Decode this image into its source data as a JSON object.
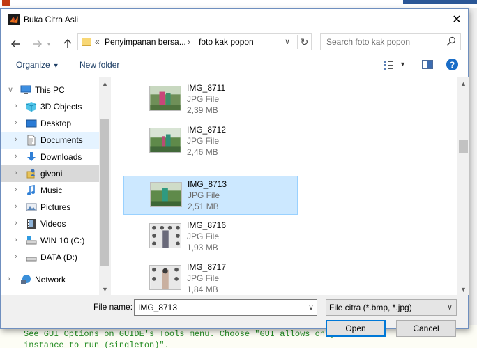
{
  "background": {
    "code_line_1": "See GUI Options on GUIDE's Tools menu.  Choose \"GUI allows only one",
    "code_line_2": "instance to run (singleton)\"."
  },
  "dialog": {
    "title": "Buka Citra Asli",
    "close_glyph": "✕"
  },
  "address": {
    "chevrons": "«",
    "segment_1": "Penyimpanan bersa...",
    "separator": "›",
    "segment_2": "foto kak popon"
  },
  "search": {
    "placeholder": "Search foto kak popon"
  },
  "toolbar": {
    "organize_label": "Organize",
    "new_folder_label": "New folder",
    "help_label": "?"
  },
  "navigation": {
    "items": [
      {
        "label": "This PC",
        "icon": "computer-icon",
        "expander": "∨"
      },
      {
        "label": "3D Objects",
        "icon": "cube-icon",
        "expander": "›"
      },
      {
        "label": "Desktop",
        "icon": "desktop-icon",
        "expander": "›"
      },
      {
        "label": "Documents",
        "icon": "document-icon",
        "expander": "›"
      },
      {
        "label": "Downloads",
        "icon": "download-icon",
        "expander": "›"
      },
      {
        "label": "givoni",
        "icon": "user-folder-icon",
        "expander": "›"
      },
      {
        "label": "Music",
        "icon": "music-icon",
        "expander": "›"
      },
      {
        "label": "Pictures",
        "icon": "pictures-icon",
        "expander": "›"
      },
      {
        "label": "Videos",
        "icon": "video-icon",
        "expander": "›"
      },
      {
        "label": "WIN 10 (C:)",
        "icon": "drive-c-icon",
        "expander": "›"
      },
      {
        "label": "DATA (D:)",
        "icon": "drive-d-icon",
        "expander": "›"
      },
      {
        "label": "Network",
        "icon": "network-icon",
        "expander": "›"
      }
    ],
    "hovered_item": "Documents",
    "selected_item": "givoni"
  },
  "files": [
    {
      "name": "IMG_8711",
      "type": "JPG File",
      "size": "2,39 MB",
      "thumbnail": "outdoor-greenery-photo"
    },
    {
      "name": "IMG_8712",
      "type": "JPG File",
      "size": "2,46 MB",
      "thumbnail": "outdoor-greenery-photo"
    },
    {
      "name": "IMG_8713",
      "type": "JPG File",
      "size": "2,51 MB",
      "thumbnail": "outdoor-greenery-photo"
    },
    {
      "name": "IMG_8716",
      "type": "JPG File",
      "size": "1,93 MB",
      "thumbnail": "patterned-backdrop-photo"
    },
    {
      "name": "IMG_8717",
      "type": "JPG File",
      "size": "1,84 MB",
      "thumbnail": "patterned-backdrop-photo"
    }
  ],
  "selected_file": "IMG_8713",
  "bottom": {
    "file_name_label": "File name:",
    "file_name_value": "IMG_8713",
    "filter_value": "File citra (*.bmp, *.jpg)",
    "open_label": "Open",
    "cancel_label": "Cancel"
  },
  "colors": {
    "selection_fill": "#cce8ff",
    "selection_border": "#99d1ff",
    "hover_fill": "#e5f3ff",
    "accent": "#0078d7",
    "link_text": "#1e3f66"
  }
}
